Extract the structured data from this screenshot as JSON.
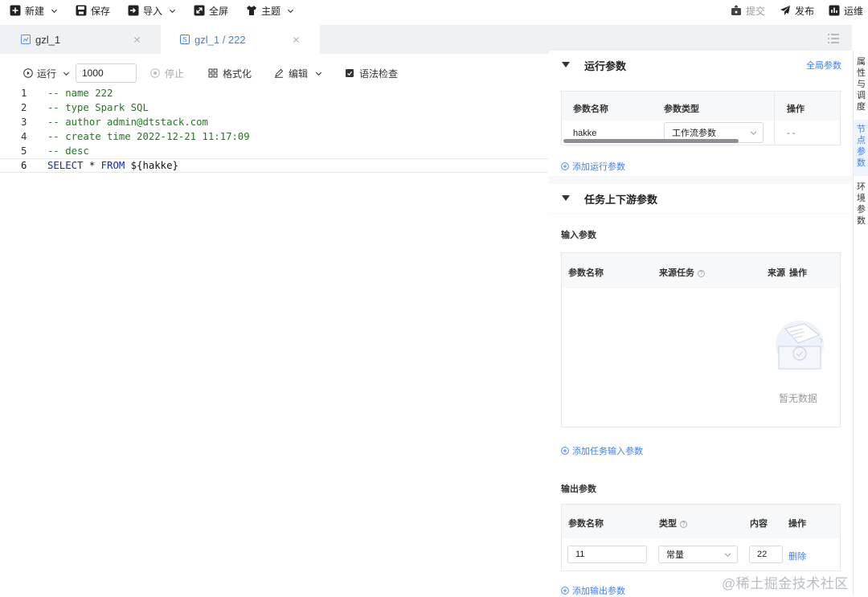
{
  "toolbar": {
    "new": "新建",
    "save": "保存",
    "import": "导入",
    "fullscreen": "全屏",
    "theme": "主题",
    "submit": "提交",
    "publish": "发布",
    "ops": "运维"
  },
  "tabs": [
    {
      "label": "gzl_1",
      "icon": "workflow-icon",
      "active": false
    },
    {
      "label": "gzl_1 / 222",
      "icon": "sql-file-icon",
      "active": true
    }
  ],
  "editor_toolbar": {
    "run": "运行",
    "limit": "1000",
    "stop": "停止",
    "format": "格式化",
    "edit": "编辑",
    "syntax_check": "语法检查"
  },
  "code": {
    "lines": [
      {
        "num": "1",
        "text": "-- name 222"
      },
      {
        "num": "2",
        "text": "-- type Spark SQL"
      },
      {
        "num": "3",
        "text": "-- author admin@dtstack.com"
      },
      {
        "num": "4",
        "text": "-- create time 2022-12-21 11:17:09"
      },
      {
        "num": "5",
        "text": "-- desc"
      },
      {
        "num": "6",
        "kw1": "SELECT",
        "op": " * ",
        "kw2": "FROM",
        "rest": " ${hakke}"
      }
    ]
  },
  "run_params": {
    "title": "运行参数",
    "global_link": "全局参数",
    "columns": {
      "name": "参数名称",
      "type": "参数类型",
      "action": "操作"
    },
    "row": {
      "name": "hakke",
      "type": "工作流参数",
      "action": "- -"
    },
    "add": "添加运行参数"
  },
  "upstream": {
    "title": "任务上下游参数",
    "input": {
      "title": "输入参数",
      "columns": {
        "name": "参数名称",
        "source_task": "来源任务",
        "source": "来源",
        "action": "操作"
      },
      "empty": "暂无数据",
      "add": "添加任务输入参数"
    },
    "output": {
      "title": "输出参数",
      "columns": {
        "name": "参数名称",
        "type": "类型",
        "content": "内容",
        "action": "操作"
      },
      "row": {
        "name": "11",
        "type": "常量",
        "content": "22",
        "delete": "删除"
      },
      "add": "添加输出参数"
    }
  },
  "side_tabs": [
    {
      "label": "属性与调度",
      "active": false
    },
    {
      "label": "节点参数",
      "active": true
    },
    {
      "label": "环境参数",
      "active": false
    }
  ],
  "watermark": "@稀土掘金技术社区",
  "colors": {
    "accent": "#3f7ef7",
    "comment": "#1f7a1f",
    "keyword": "#0f2eb0",
    "panel_bg": "#f7f8fa"
  }
}
